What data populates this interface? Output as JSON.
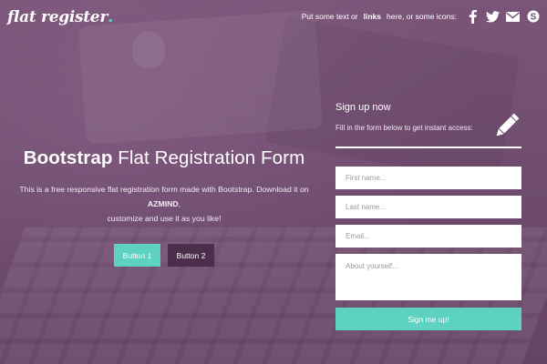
{
  "brand": {
    "logo_text": "flat register",
    "logo_dot": ".",
    "accent": "#5ed2c0",
    "dark_button": "#4b2f4a",
    "overlay": "#6d4a6c"
  },
  "topbar": {
    "text_before": "Put some text or",
    "link": "links",
    "text_after": "here, or some icons:",
    "icons": [
      "facebook-icon",
      "twitter-icon",
      "email-icon",
      "skype-icon"
    ]
  },
  "hero": {
    "title_bold": "Bootstrap",
    "title_rest": "Flat Registration Form",
    "desc_line1": "This is a free responsive flat registration form made with Bootstrap. Download it on",
    "desc_brand": "AZMIND",
    "desc_line2": "customize and use it as you like!",
    "button1": "Button 1",
    "button2": "Button 2"
  },
  "form": {
    "title": "Sign up now",
    "subtitle": "Fill in the form below to get instant access:",
    "icon": "pencil-icon",
    "first_name_placeholder": "First name...",
    "last_name_placeholder": "Last name...",
    "email_placeholder": "Email...",
    "about_placeholder": "About yourself...",
    "submit": "Sign me up!"
  }
}
